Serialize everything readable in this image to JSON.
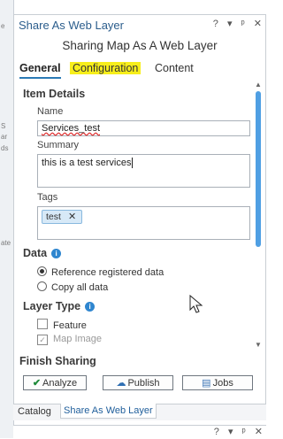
{
  "background_panel": {
    "labels": [
      "e",
      "S",
      "ar",
      "ds",
      "ate"
    ]
  },
  "pane": {
    "title": "Share As Web Layer",
    "controls": {
      "help": "?",
      "dropdown": "▾",
      "pin": "ᵖ",
      "close": "✕"
    }
  },
  "heading": "Sharing Map As A Web Layer",
  "tabs": [
    {
      "label": "General",
      "active": true
    },
    {
      "label": "Configuration",
      "highlighted": true,
      "highlight_color": "#f7ee1b"
    },
    {
      "label": "Content"
    }
  ],
  "item_details": {
    "title": "Item Details",
    "name_label": "Name",
    "name_value": "Services_test",
    "summary_label": "Summary",
    "summary_value": "this is a test services",
    "tags_label": "Tags",
    "tags": [
      "test"
    ],
    "chip_remove": "✕"
  },
  "data": {
    "title": "Data",
    "info_icon": "i",
    "options": [
      {
        "label": "Reference registered data",
        "selected": true
      },
      {
        "label": "Copy all data",
        "selected": false
      }
    ]
  },
  "layer_type": {
    "title": "Layer Type",
    "info_icon": "i",
    "options": [
      {
        "label": "Feature",
        "checked": false,
        "disabled": false
      },
      {
        "label": "Map Image",
        "checked": true,
        "disabled": true
      }
    ]
  },
  "finish": {
    "title": "Finish Sharing",
    "buttons": {
      "analyze": "Analyze",
      "publish": "Publish",
      "jobs": "Jobs"
    }
  },
  "bottom_tabs": [
    {
      "label": "Catalog",
      "active": false
    },
    {
      "label": "Share As Web Layer",
      "active": true
    }
  ],
  "second_pane": {
    "controls": {
      "help": "?",
      "dropdown": "▾",
      "pin": "ᵖ",
      "close": "✕"
    }
  },
  "colors": {
    "accent": "#2a7ab5",
    "title_blue": "#2b5d8c",
    "scroll_thumb": "#4f9fe3"
  }
}
